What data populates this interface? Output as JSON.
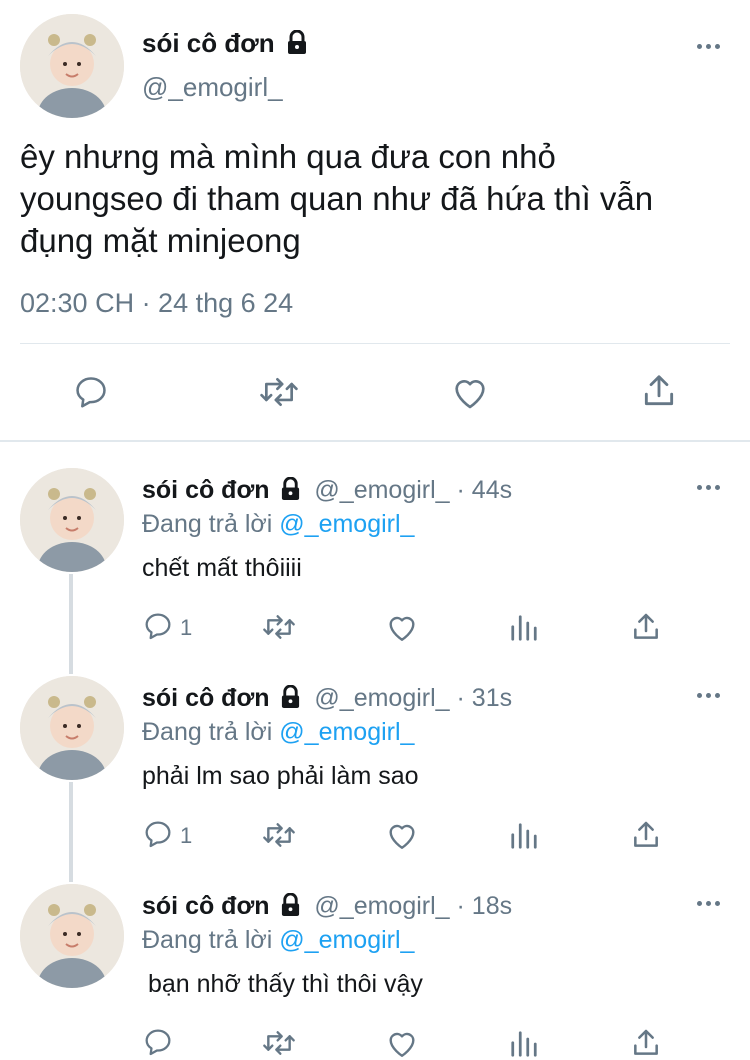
{
  "main_tweet": {
    "display_name": "sói cô đơn",
    "handle": "@_emogirl_",
    "text_lines": [
      "êy nhưng mà mình qua đưa con nhỏ",
      "youngseo đi tham quan như đã hứa thì vẫn",
      "đụng mặt minjeong"
    ],
    "timestamp": "02:30 CH · 24 thg 6 24",
    "actions": [
      "reply-icon",
      "retweet-icon",
      "like-icon",
      "share-icon"
    ]
  },
  "replies": [
    {
      "display_name": "sói cô đơn",
      "handle_time": "@_emogirl_ · 44s",
      "replying_prefix": "Đang trả lời",
      "replying_to": "@_emogirl_",
      "text": "chết mất thôiiii",
      "reply_count": "1"
    },
    {
      "display_name": "sói cô đơn",
      "handle_time": "@_emogirl_ · 31s",
      "replying_prefix": "Đang trả lời",
      "replying_to": "@_emogirl_",
      "text": "phải lm sao phải làm sao",
      "reply_count": "1"
    },
    {
      "display_name": "sói cô đơn",
      "handle_time": "@_emogirl_ · 18s",
      "replying_prefix": "Đang trả lời",
      "replying_to": "@_emogirl_",
      "text": "bạn nhỡ thấy thì thôi vậy",
      "reply_count": ""
    }
  ],
  "colors": {
    "text": "#14171a",
    "muted": "#657786",
    "link": "#1da1f2",
    "divider": "#e1e8ed"
  }
}
